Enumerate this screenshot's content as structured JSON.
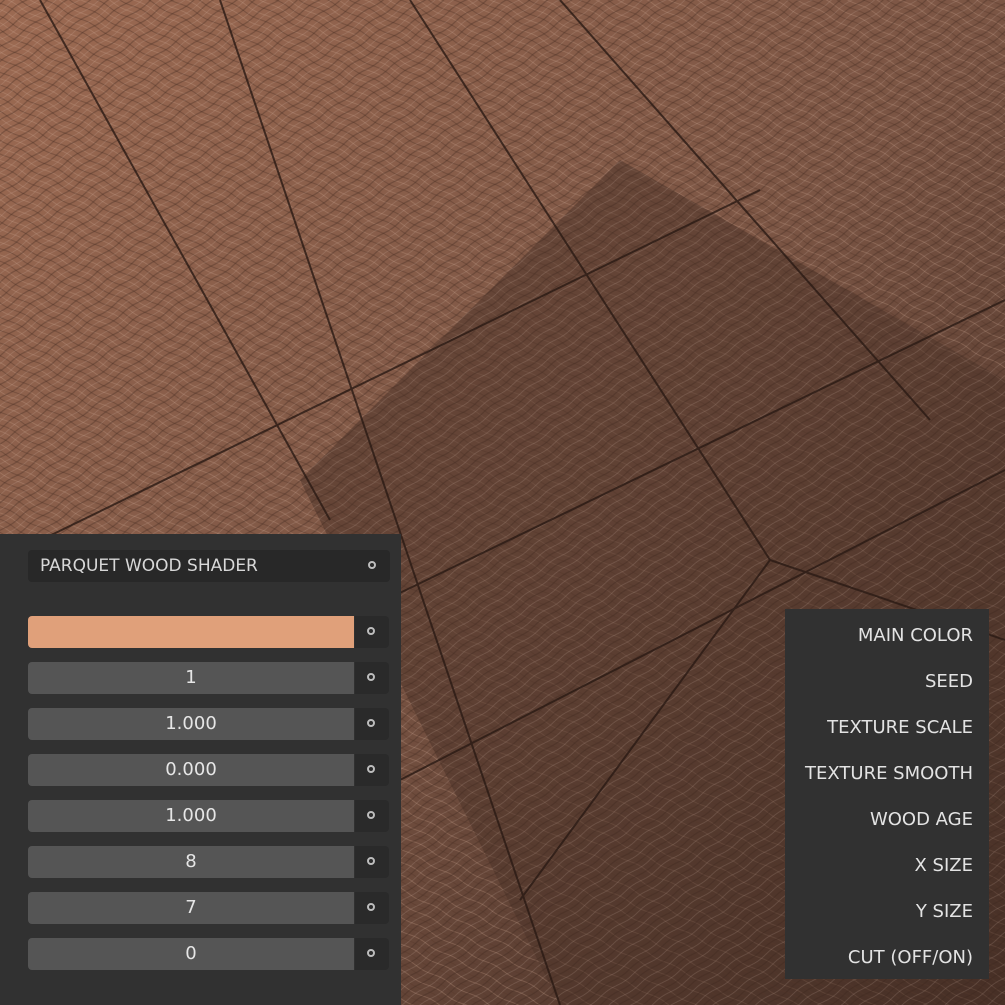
{
  "panel": {
    "title": "PARQUET WOOD SHADER",
    "values": [
      "",
      "1",
      "1.000",
      "0.000",
      "1.000",
      "8",
      "7",
      "0"
    ],
    "main_color": "#e0a07a"
  },
  "labels": [
    "MAIN COLOR",
    "SEED",
    "TEXTURE SCALE",
    "TEXTURE SMOOTH",
    "WOOD AGE",
    "X SIZE",
    "Y SIZE",
    "CUT (OFF/ON)"
  ]
}
